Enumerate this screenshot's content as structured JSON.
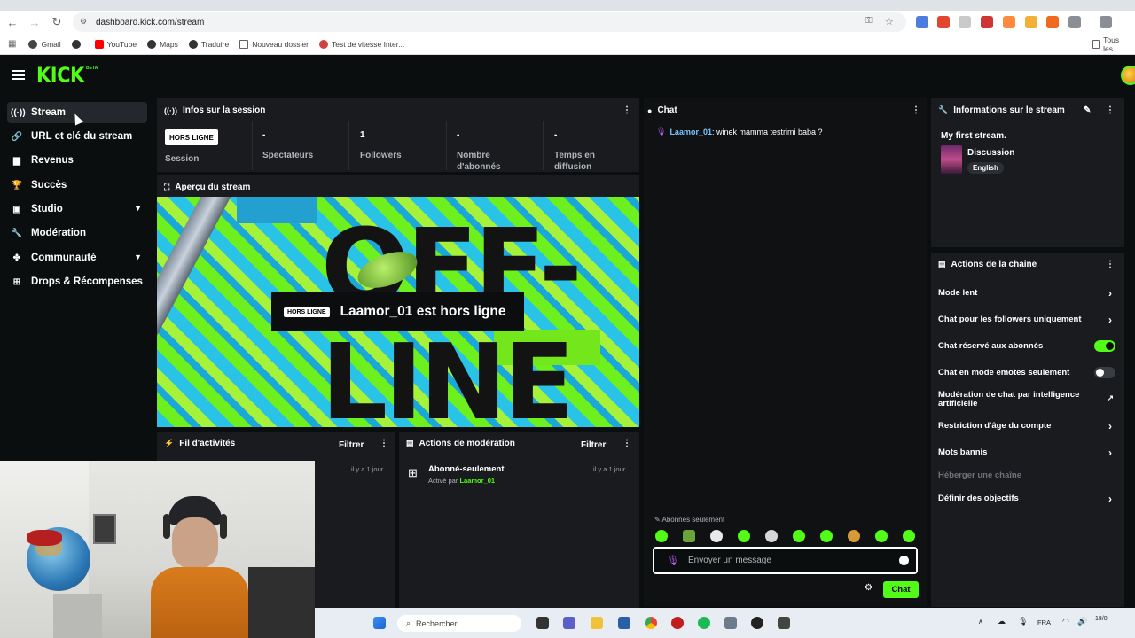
{
  "browser": {
    "url": "dashboard.kick.com/stream",
    "bookmarks": [
      "Gmail",
      "YouTube",
      "Maps",
      "Traduire",
      "Nouveau dossier",
      "Test de vitesse Inter..."
    ],
    "all_bookmarks": "Tous les"
  },
  "header": {
    "logo": "KICK",
    "beta": "BETA"
  },
  "sidebar": {
    "items": [
      {
        "label": "Stream",
        "icon": "stream-icon"
      },
      {
        "label": "URL et clé du stream",
        "icon": "link-icon"
      },
      {
        "label": "Revenus",
        "icon": "revenue-icon"
      },
      {
        "label": "Succès",
        "icon": "trophy-icon"
      },
      {
        "label": "Studio",
        "icon": "studio-icon"
      },
      {
        "label": "Modération",
        "icon": "wrench-icon"
      },
      {
        "label": "Communauté",
        "icon": "community-icon"
      },
      {
        "label": "Drops & Récompenses",
        "icon": "gift-icon"
      }
    ]
  },
  "session": {
    "title": "Infos sur la session",
    "badge": "HORS LIGNE",
    "session_label": "Session",
    "stats": [
      {
        "value": "-",
        "label": "Spectateurs"
      },
      {
        "value": "1",
        "label": "Followers"
      },
      {
        "value": "-",
        "label": "Nombre d'abonnés"
      },
      {
        "value": "-",
        "label": "Temps en diffusion"
      }
    ]
  },
  "preview": {
    "title": "Aperçu du stream",
    "offline_badge": "HORS LIGNE",
    "offline_text": "Laamor_01 est hors ligne",
    "bg_text_top": "OFF-",
    "bg_text_bottom": "LINE"
  },
  "activity": {
    "title": "Fil d'activités",
    "filter": "Filtrer",
    "time": "il y a 1 jour"
  },
  "moderation": {
    "title": "Actions de modération",
    "filter": "Filtrer",
    "time": "il y a 1 jour",
    "event_title": "Abonné-seulement",
    "event_by": "Activé par",
    "event_user": "Laamor_01"
  },
  "chat": {
    "title": "Chat",
    "message_user": "Laamor_01",
    "message_text": ": winek mamma testrimi baba ?",
    "sub_only": "Abonnés seulement",
    "placeholder": "Envoyer un message",
    "send": "Chat"
  },
  "stream_info": {
    "title": "Informations sur le stream",
    "stream_name": "My first stream.",
    "category": "Discussion",
    "language": "English"
  },
  "channel_actions": {
    "title": "Actions de la chaîne",
    "items": [
      {
        "label": "Mode lent",
        "control": "arrow"
      },
      {
        "label": "Chat pour les followers uniquement",
        "control": "arrow"
      },
      {
        "label": "Chat réservé aux abonnés",
        "control": "toggle",
        "on": true
      },
      {
        "label": "Chat en mode emotes seulement",
        "control": "toggle",
        "on": false
      },
      {
        "label": "Modération de chat par intelligence artificielle",
        "control": "external"
      },
      {
        "label": "Restriction d'âge du compte",
        "control": "arrow"
      },
      {
        "label": "Mots bannis",
        "control": "arrow"
      },
      {
        "label": "Héberger une chaîne",
        "control": "none",
        "disabled": true
      },
      {
        "label": "Définir des objectifs",
        "control": "arrow"
      }
    ]
  },
  "taskbar": {
    "search": "Rechercher",
    "lang": "FRA",
    "time": "18/0"
  },
  "colors": {
    "accent": "#53fc18",
    "panel": "#191b1f",
    "background": "#0b0e0f"
  }
}
